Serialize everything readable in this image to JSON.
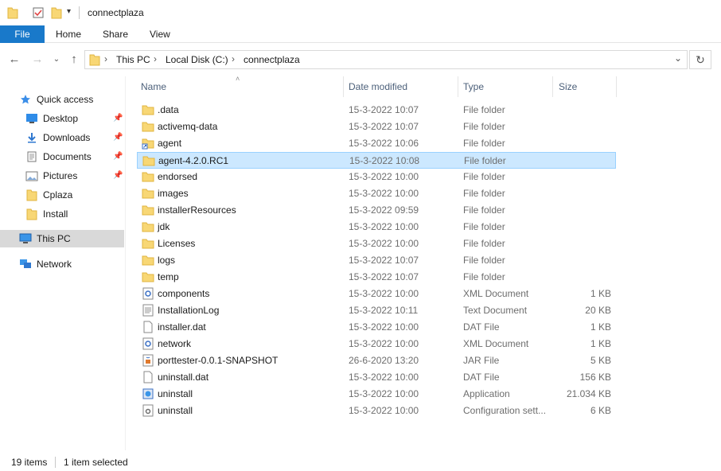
{
  "window": {
    "title": "connectplaza"
  },
  "ribbon": {
    "tabs": [
      "File",
      "Home",
      "Share",
      "View"
    ]
  },
  "address": {
    "crumbs": [
      "This PC",
      "Local Disk (C:)",
      "connectplaza"
    ]
  },
  "sidebar": {
    "items": [
      {
        "label": "Quick access",
        "icon": "star-icon"
      },
      {
        "label": "Desktop",
        "icon": "desktop-icon",
        "pinned": true
      },
      {
        "label": "Downloads",
        "icon": "download-icon",
        "pinned": true
      },
      {
        "label": "Documents",
        "icon": "documents-icon",
        "pinned": true
      },
      {
        "label": "Pictures",
        "icon": "pictures-icon",
        "pinned": true
      },
      {
        "label": "Cplaza",
        "icon": "folder-icon"
      },
      {
        "label": "Install",
        "icon": "folder-icon"
      },
      {
        "label": "This PC",
        "icon": "computer-icon",
        "selected": true
      },
      {
        "label": "Network",
        "icon": "network-icon"
      }
    ]
  },
  "columns": {
    "name": "Name",
    "date": "Date modified",
    "type": "Type",
    "size": "Size"
  },
  "files": [
    {
      "name": ".data",
      "date": "15-3-2022 10:07",
      "type": "File folder",
      "size": "",
      "icon": "folder"
    },
    {
      "name": "activemq-data",
      "date": "15-3-2022 10:07",
      "type": "File folder",
      "size": "",
      "icon": "folder"
    },
    {
      "name": "agent",
      "date": "15-3-2022 10:06",
      "type": "File folder",
      "size": "",
      "icon": "folder-shortcut"
    },
    {
      "name": "agent-4.2.0.RC1",
      "date": "15-3-2022 10:08",
      "type": "File folder",
      "size": "",
      "icon": "folder",
      "selected": true
    },
    {
      "name": "endorsed",
      "date": "15-3-2022 10:00",
      "type": "File folder",
      "size": "",
      "icon": "folder"
    },
    {
      "name": "images",
      "date": "15-3-2022 10:00",
      "type": "File folder",
      "size": "",
      "icon": "folder"
    },
    {
      "name": "installerResources",
      "date": "15-3-2022 09:59",
      "type": "File folder",
      "size": "",
      "icon": "folder"
    },
    {
      "name": "jdk",
      "date": "15-3-2022 10:00",
      "type": "File folder",
      "size": "",
      "icon": "folder"
    },
    {
      "name": "Licenses",
      "date": "15-3-2022 10:00",
      "type": "File folder",
      "size": "",
      "icon": "folder"
    },
    {
      "name": "logs",
      "date": "15-3-2022 10:07",
      "type": "File folder",
      "size": "",
      "icon": "folder"
    },
    {
      "name": "temp",
      "date": "15-3-2022 10:07",
      "type": "File folder",
      "size": "",
      "icon": "folder"
    },
    {
      "name": "components",
      "date": "15-3-2022 10:00",
      "type": "XML Document",
      "size": "1 KB",
      "icon": "xml"
    },
    {
      "name": "InstallationLog",
      "date": "15-3-2022 10:11",
      "type": "Text Document",
      "size": "20 KB",
      "icon": "text"
    },
    {
      "name": "installer.dat",
      "date": "15-3-2022 10:00",
      "type": "DAT File",
      "size": "1 KB",
      "icon": "file"
    },
    {
      "name": "network",
      "date": "15-3-2022 10:00",
      "type": "XML Document",
      "size": "1 KB",
      "icon": "xml"
    },
    {
      "name": "porttester-0.0.1-SNAPSHOT",
      "date": "26-6-2020 13:20",
      "type": "JAR File",
      "size": "5 KB",
      "icon": "jar"
    },
    {
      "name": "uninstall.dat",
      "date": "15-3-2022 10:00",
      "type": "DAT File",
      "size": "156 KB",
      "icon": "file"
    },
    {
      "name": "uninstall",
      "date": "15-3-2022 10:00",
      "type": "Application",
      "size": "21.034 KB",
      "icon": "app"
    },
    {
      "name": "uninstall",
      "date": "15-3-2022 10:00",
      "type": "Configuration sett...",
      "size": "6 KB",
      "icon": "config"
    }
  ],
  "status": {
    "count": "19 items",
    "selection": "1 item selected"
  }
}
